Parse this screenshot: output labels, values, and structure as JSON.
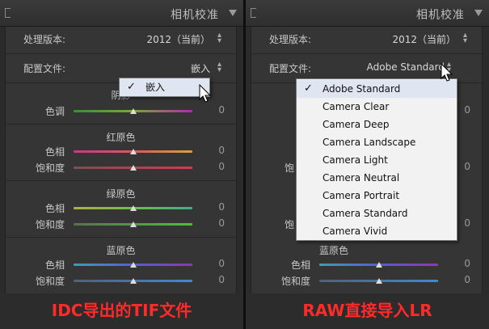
{
  "left": {
    "header_title": "相机校准",
    "process_label": "处理版本:",
    "process_value": "2012（当前）",
    "profile_label": "配置文件:",
    "profile_value": "嵌入",
    "shadows_title": "阴影",
    "shadows_tint_label": "色调",
    "shadows_tint_value": "0",
    "red_title": "红原色",
    "red_hue_label": "色相",
    "red_hue_value": "0",
    "red_sat_label": "饱和度",
    "red_sat_value": "0",
    "green_title": "绿原色",
    "green_hue_label": "色相",
    "green_hue_value": "0",
    "green_sat_label": "饱和度",
    "green_sat_value": "0",
    "blue_title": "蓝原色",
    "blue_hue_label": "色相",
    "blue_hue_value": "0",
    "blue_sat_label": "饱和度",
    "blue_sat_value": "0",
    "dropdown_item": "嵌入",
    "caption": "IDC导出的TIF文件"
  },
  "right": {
    "header_title": "相机校准",
    "process_label": "处理版本:",
    "process_value": "2012（当前）",
    "profile_label": "配置文件:",
    "profile_value": "Adobe Standard",
    "blue_title": "蓝原色",
    "blue_hue_label": "色相",
    "blue_hue_value": "0",
    "blue_sat_label": "饱和度",
    "blue_sat_value": "0",
    "hidden_label_1": "饱",
    "hidden_label_2": "饱",
    "hidden_value": "0",
    "menu_items": [
      "Adobe Standard",
      "Camera Clear",
      "Camera Deep",
      "Camera Landscape",
      "Camera Light",
      "Camera Neutral",
      "Camera Portrait",
      "Camera Standard",
      "Camera Vivid"
    ],
    "caption": "RAW直接导入LR"
  },
  "colors": {
    "panel_bg": "#2b2b2b",
    "body_bg": "#353535",
    "caption_red": "#ff2a2a",
    "shadow_track": "#7a9a3a",
    "red_track": "#d65a6a",
    "green_track": "#6bbf45",
    "blue_track": "#5a5ad6",
    "menu_bg": "#f2f2f2"
  },
  "icons": [
    "check-icon",
    "cursor-icon",
    "collapse-triangle-icon",
    "spinner-icon"
  ]
}
